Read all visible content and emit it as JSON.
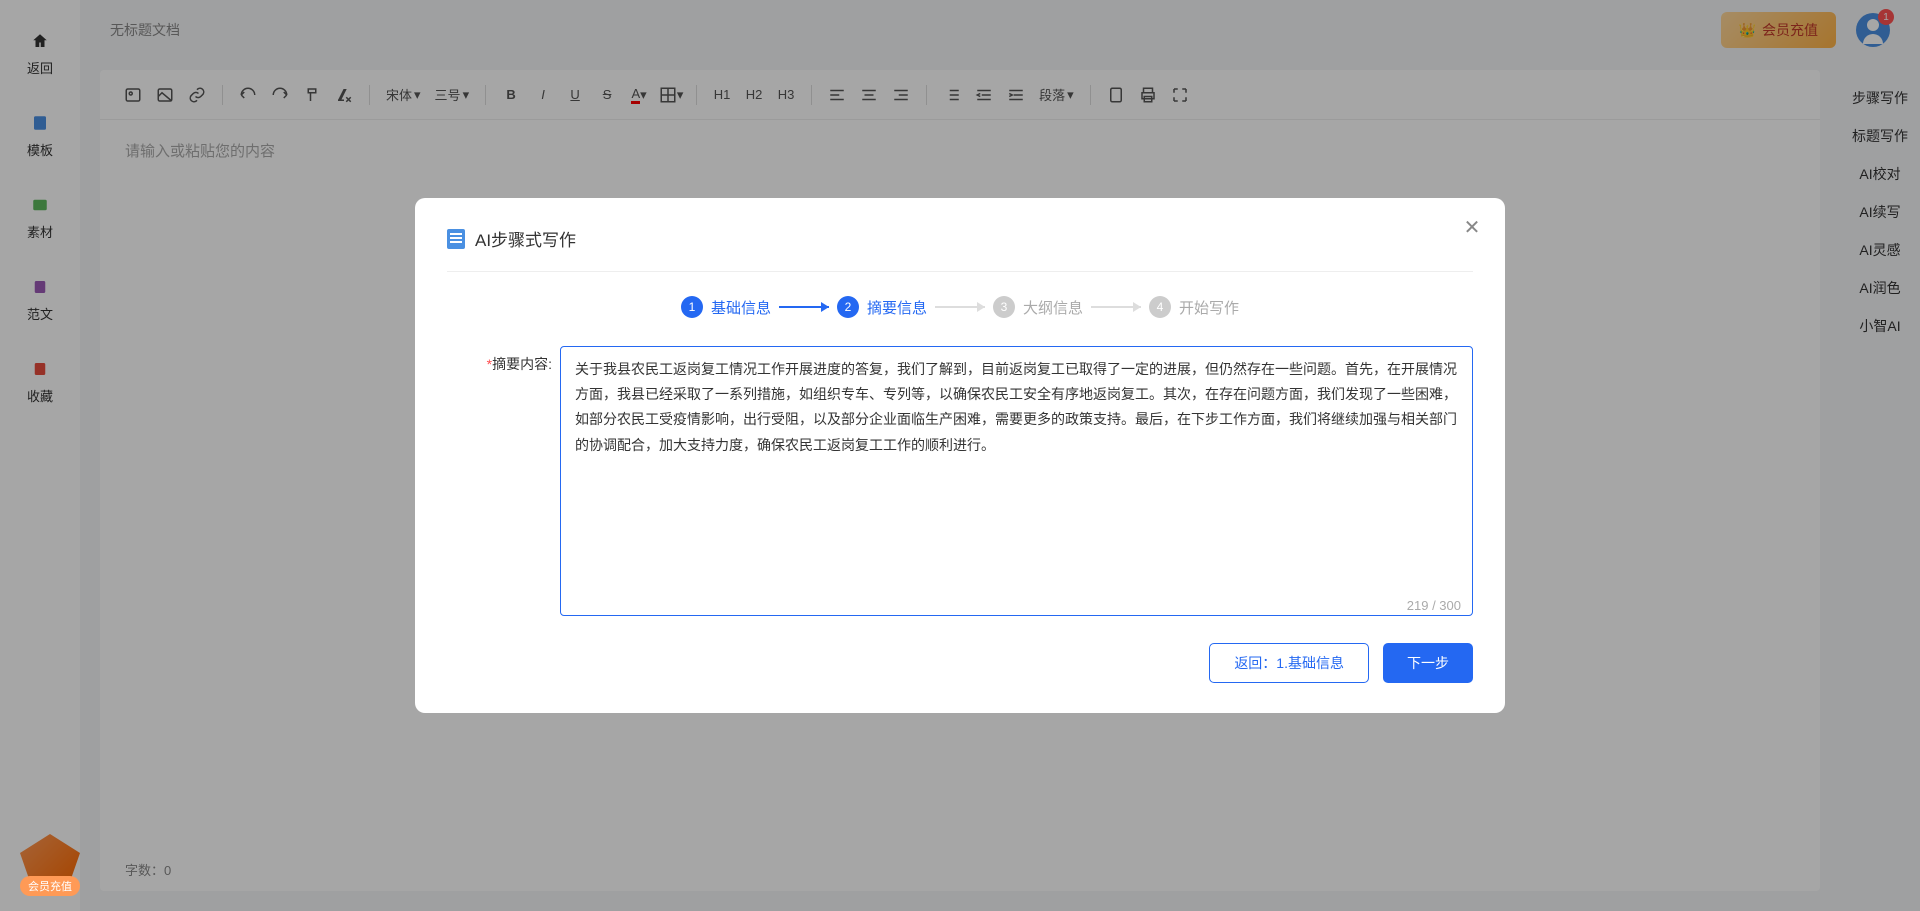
{
  "doc_title": "无标题文档",
  "left_nav": {
    "back": "返回",
    "template": "模板",
    "material": "素材",
    "sample": "范文",
    "favorite": "收藏"
  },
  "promo_label": "会员充值",
  "header": {
    "vip_button": "会员充值",
    "notification_count": "1"
  },
  "toolbar": {
    "font": "宋体",
    "size": "三号",
    "h1": "H1",
    "h2": "H2",
    "h3": "H3",
    "paragraph": "段落"
  },
  "editor": {
    "placeholder": "请输入或粘贴您的内容",
    "word_count_label": "字数：",
    "word_count": "0"
  },
  "right_nav": {
    "step_write": "步骤写作",
    "title_write": "标题写作",
    "ai_proof": "AI校对",
    "ai_continue": "AI续写",
    "ai_inspire": "AI灵感",
    "ai_polish": "AI润色",
    "xiaozhi": "小智AI"
  },
  "modal": {
    "title": "AI步骤式写作",
    "steps": {
      "s1": "基础信息",
      "s2": "摘要信息",
      "s3": "大纲信息",
      "s4": "开始写作",
      "n1": "1",
      "n2": "2",
      "n3": "3",
      "n4": "4"
    },
    "form": {
      "label": "摘要内容:",
      "value": "关于我县农民工返岗复工情况工作开展进度的答复，我们了解到，目前返岗复工已取得了一定的进展，但仍然存在一些问题。首先，在开展情况方面，我县已经采取了一系列措施，如组织专车、专列等，以确保农民工安全有序地返岗复工。其次，在存在问题方面，我们发现了一些困难，如部分农民工受疫情影响，出行受阻，以及部分企业面临生产困难，需要更多的政策支持。最后，在下步工作方面，我们将继续加强与相关部门的协调配合，加大支持力度，确保农民工返岗复工工作的顺利进行。",
      "char_count": "219 / 300"
    },
    "footer": {
      "back_btn": "返回：1.基础信息",
      "next_btn": "下一步"
    }
  }
}
